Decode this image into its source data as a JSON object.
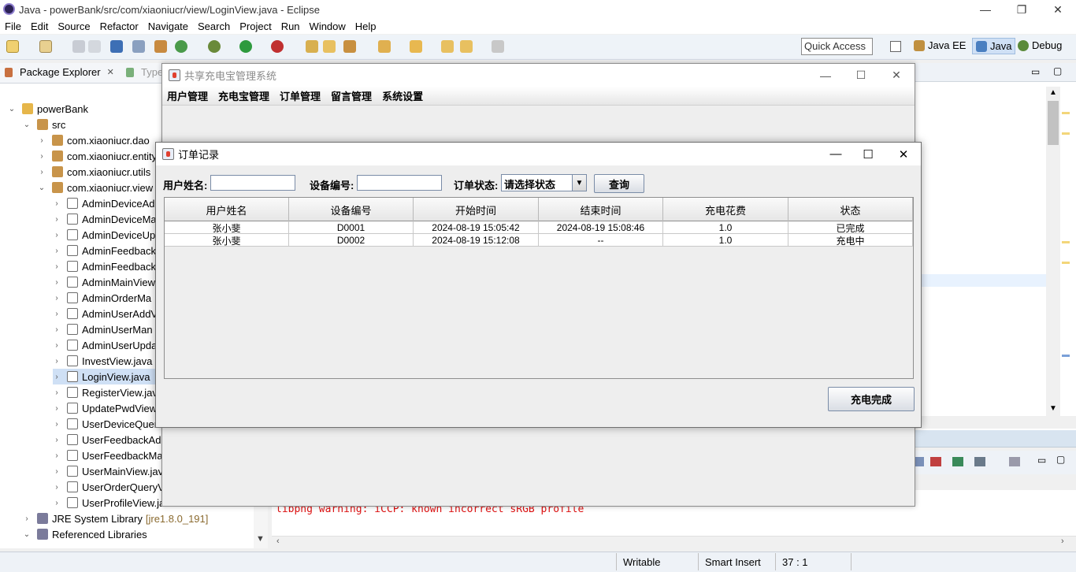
{
  "eclipse": {
    "window_title": "Java - powerBank/src/com/xiaoniucr/view/LoginView.java - Eclipse",
    "menu": [
      "File",
      "Edit",
      "Source",
      "Refactor",
      "Navigate",
      "Search",
      "Project",
      "Run",
      "Window",
      "Help"
    ],
    "quick_access": "Quick Access",
    "perspectives": [
      "Java EE",
      "Java",
      "Debug"
    ],
    "view_tabs": [
      "Package Explorer",
      "Type"
    ],
    "tree": [
      {
        "label": "powerBank",
        "depth": 0,
        "icon": "project",
        "twisty": "open"
      },
      {
        "label": "src",
        "depth": 1,
        "icon": "package-folder",
        "twisty": "open"
      },
      {
        "label": "com.xiaoniucr.dao",
        "depth": 2,
        "icon": "package",
        "twisty": "closed"
      },
      {
        "label": "com.xiaoniucr.entity",
        "depth": 2,
        "icon": "package",
        "twisty": "closed"
      },
      {
        "label": "com.xiaoniucr.utils",
        "depth": 2,
        "icon": "package",
        "twisty": "closed"
      },
      {
        "label": "com.xiaoniucr.view",
        "depth": 2,
        "icon": "package",
        "twisty": "open"
      },
      {
        "label": "AdminDeviceAd",
        "depth": 3,
        "icon": "java-file",
        "twisty": "closed"
      },
      {
        "label": "AdminDeviceMa",
        "depth": 3,
        "icon": "java-file",
        "twisty": "closed"
      },
      {
        "label": "AdminDeviceUp",
        "depth": 3,
        "icon": "java-file",
        "twisty": "closed"
      },
      {
        "label": "AdminFeedback",
        "depth": 3,
        "icon": "java-file",
        "twisty": "closed"
      },
      {
        "label": "AdminFeedback",
        "depth": 3,
        "icon": "java-file",
        "twisty": "closed"
      },
      {
        "label": "AdminMainView",
        "depth": 3,
        "icon": "java-file",
        "twisty": "closed"
      },
      {
        "label": "AdminOrderMa",
        "depth": 3,
        "icon": "java-file",
        "twisty": "closed"
      },
      {
        "label": "AdminUserAddV",
        "depth": 3,
        "icon": "java-file",
        "twisty": "closed"
      },
      {
        "label": "AdminUserMan",
        "depth": 3,
        "icon": "java-file",
        "twisty": "closed"
      },
      {
        "label": "AdminUserUpda",
        "depth": 3,
        "icon": "java-file",
        "twisty": "closed"
      },
      {
        "label": "InvestView.java",
        "depth": 3,
        "icon": "java-file",
        "twisty": "closed"
      },
      {
        "label": "LoginView.java",
        "depth": 3,
        "icon": "java-file",
        "twisty": "closed",
        "selected": true
      },
      {
        "label": "RegisterView.jav",
        "depth": 3,
        "icon": "java-file",
        "twisty": "closed"
      },
      {
        "label": "UpdatePwdView",
        "depth": 3,
        "icon": "java-file",
        "twisty": "closed"
      },
      {
        "label": "UserDeviceQuer",
        "depth": 3,
        "icon": "java-file",
        "twisty": "closed"
      },
      {
        "label": "UserFeedbackAd",
        "depth": 3,
        "icon": "java-file",
        "twisty": "closed"
      },
      {
        "label": "UserFeedbackMa",
        "depth": 3,
        "icon": "java-file",
        "twisty": "closed"
      },
      {
        "label": "UserMainView.jav",
        "depth": 3,
        "icon": "java-file",
        "twisty": "closed"
      },
      {
        "label": "UserOrderQueryV",
        "depth": 3,
        "icon": "java-file",
        "twisty": "closed"
      },
      {
        "label": "UserProfileView.java",
        "depth": 3,
        "icon": "java-file",
        "twisty": "closed"
      },
      {
        "label": "JRE System Library",
        "suffix": "[jre1.8.0_191]",
        "depth": 1,
        "icon": "library",
        "twisty": "closed"
      },
      {
        "label": "Referenced Libraries",
        "depth": 1,
        "icon": "library",
        "twisty": "open"
      }
    ],
    "console_text": "libpng warning: iCCP: known incorrect sRGB profile",
    "status": {
      "writable": "Writable",
      "insert_mode": "Smart Insert",
      "position": "37 : 1"
    }
  },
  "main_window": {
    "title": "共享充电宝管理系统",
    "menu": [
      "用户管理",
      "充电宝管理",
      "订单管理",
      "留言管理",
      "系统设置"
    ]
  },
  "order_window": {
    "title": "订单记录",
    "filters": {
      "username_label": "用户姓名:",
      "username_value": "",
      "device_label": "设备编号:",
      "device_value": "",
      "status_label": "订单状态:",
      "status_selected": "请选择状态",
      "query_button": "查询"
    },
    "table": {
      "columns": [
        "用户姓名",
        "设备编号",
        "开始时间",
        "结束时间",
        "充电花费",
        "状态"
      ],
      "rows": [
        [
          "张小斐",
          "D0001",
          "2024-08-19 15:05:42",
          "2024-08-19 15:08:46",
          "1.0",
          "已完成"
        ],
        [
          "张小斐",
          "D0002",
          "2024-08-19 15:12:08",
          "--",
          "1.0",
          "充电中"
        ]
      ]
    },
    "complete_button": "充电完成"
  }
}
